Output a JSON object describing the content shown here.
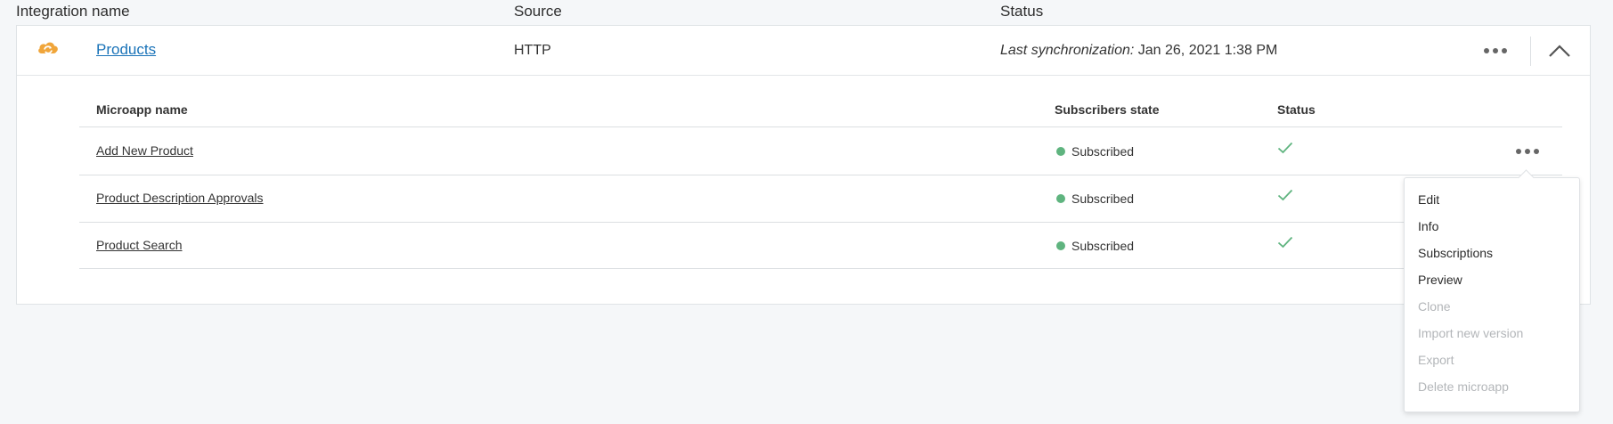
{
  "columns": {
    "integration_name": "Integration name",
    "source": "Source",
    "status": "Status"
  },
  "integration": {
    "name": "Products",
    "source": "HTTP",
    "sync_label": "Last synchronization:",
    "sync_value": "Jan 26, 2021 1:38 PM",
    "icon": "cloud-sync-icon",
    "icon_color": "#e8962d"
  },
  "microapps": {
    "headers": {
      "name": "Microapp name",
      "subscribers_state": "Subscribers state",
      "status": "Status"
    },
    "rows": [
      {
        "name": "Add New Product",
        "state": "Subscribed"
      },
      {
        "name": "Product Description Approvals",
        "state": "Subscribed"
      },
      {
        "name": "Product Search",
        "state": "Subscribed"
      }
    ]
  },
  "menu": {
    "items": [
      {
        "label": "Edit",
        "enabled": true
      },
      {
        "label": "Info",
        "enabled": true
      },
      {
        "label": "Subscriptions",
        "enabled": true
      },
      {
        "label": "Preview",
        "enabled": true
      },
      {
        "label": "Clone",
        "enabled": false
      },
      {
        "label": "Import new version",
        "enabled": false
      },
      {
        "label": "Export",
        "enabled": false
      },
      {
        "label": "Delete microapp",
        "enabled": false
      }
    ]
  },
  "colors": {
    "link": "#1a73b8",
    "subscribed_dot": "#5fb47f",
    "check": "#5fb47f",
    "disabled_text": "#b3b6b9"
  }
}
